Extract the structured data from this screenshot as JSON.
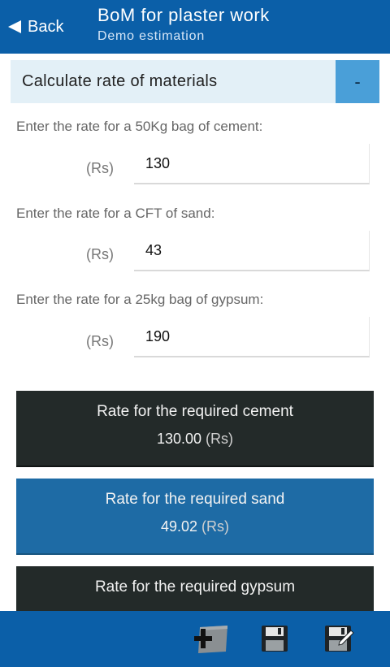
{
  "header": {
    "back_label": "Back",
    "title": "BoM for plaster work",
    "subtitle": "Demo estimation"
  },
  "section": {
    "title": "Calculate rate of materials",
    "toggle_label": "-"
  },
  "fields": [
    {
      "label": "Enter the rate for a 50Kg bag of cement:",
      "unit": "(Rs)",
      "value": "130"
    },
    {
      "label": "Enter the rate for a CFT of sand:",
      "unit": "(Rs)",
      "value": "43"
    },
    {
      "label": "Enter the rate for a 25kg bag of gypsum:",
      "unit": "(Rs)",
      "value": "190"
    }
  ],
  "results": [
    {
      "label": "Rate for the required cement",
      "value": "130.00",
      "unit": "(Rs)"
    },
    {
      "label": "Rate for the required sand",
      "value": "49.02",
      "unit": "(Rs)"
    },
    {
      "label": "Rate for the required gypsum",
      "value": "",
      "unit": ""
    }
  ],
  "toolbar": {
    "icons": [
      "add-document-icon",
      "save-icon",
      "save-as-icon"
    ]
  },
  "colors": {
    "primary": "#0b5fa8",
    "section_bg": "#e3f0f7",
    "toggle_bg": "#4a9fd8",
    "card_dark": "#232a29",
    "card_blue": "#1e6ba5"
  }
}
